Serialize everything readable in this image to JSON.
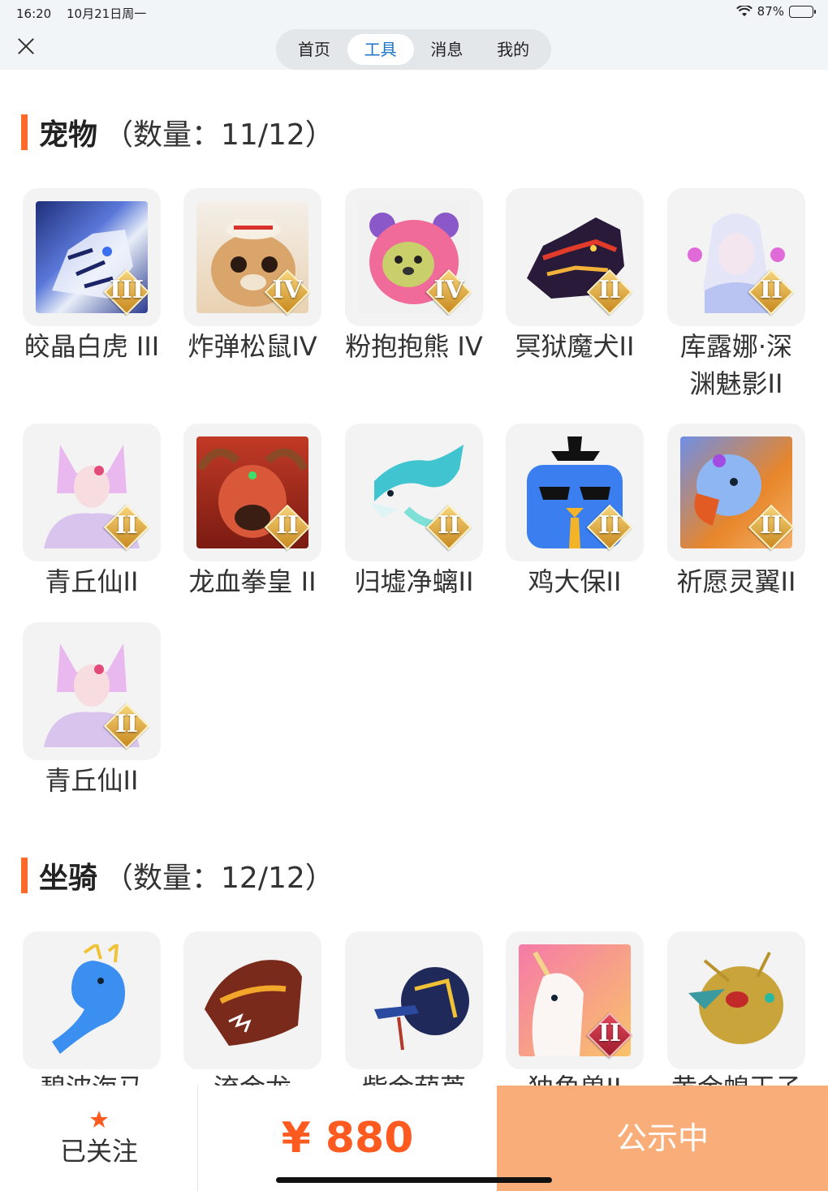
{
  "status_bar": {
    "time": "16:20",
    "date": "10月21日周一",
    "battery": "87%"
  },
  "nav": {
    "tabs": [
      {
        "label": "首页",
        "active": false
      },
      {
        "label": "工具",
        "active": true
      },
      {
        "label": "消息",
        "active": false
      },
      {
        "label": "我的",
        "active": false
      }
    ]
  },
  "pets": {
    "title": "宠物",
    "count": "（数量：11/12）",
    "items": [
      {
        "name": "皎晶白虎 III",
        "tier": "III",
        "icon": "white-tiger-icon"
      },
      {
        "name": "炸弹松鼠IV",
        "tier": "IV",
        "icon": "bomb-squirrel-icon"
      },
      {
        "name": "粉抱抱熊 IV",
        "tier": "IV",
        "icon": "pink-bear-icon"
      },
      {
        "name": "冥狱魔犬II",
        "tier": "II",
        "icon": "hell-hound-icon"
      },
      {
        "name_line1": "库露娜·深",
        "name_line2": "渊魅影II",
        "tier": "II",
        "icon": "kuluna-icon"
      },
      {
        "name": "青丘仙II",
        "tier": "II",
        "icon": "fox-fairy-icon"
      },
      {
        "name": "龙血拳皇 II",
        "tier": "II",
        "icon": "dragon-boxer-icon"
      },
      {
        "name": "归墟净螭II",
        "tier": "II",
        "icon": "jade-dragon-icon"
      },
      {
        "name": "鸡大保II",
        "tier": "II",
        "icon": "chicken-icon"
      },
      {
        "name": "祈愿灵翼II",
        "tier": "II",
        "icon": "spirit-bird-icon"
      },
      {
        "name": "青丘仙II",
        "tier": "II",
        "icon": "fox-fairy-icon"
      }
    ]
  },
  "mounts": {
    "title": "坐骑",
    "count": "（数量：12/12）",
    "items": [
      {
        "name": "碧波海马",
        "icon": "seahorse-icon"
      },
      {
        "name": "流金龙",
        "icon": "gold-dragon-icon"
      },
      {
        "name": "紫金葫芦",
        "icon": "gourd-icon"
      },
      {
        "name": "独角兽II",
        "tier": "II",
        "icon": "unicorn-icon"
      },
      {
        "name": "黄金蝗王子",
        "icon": "gold-locust-icon"
      }
    ]
  },
  "bottom_bar": {
    "follow_label": "已关注",
    "price": "¥ 880",
    "action_label": "公示中"
  },
  "colors": {
    "accent": "#ff6a2a",
    "price": "#ff5a1f",
    "action_bg": "#f9ad78",
    "tab_active": "#1a73c8"
  }
}
